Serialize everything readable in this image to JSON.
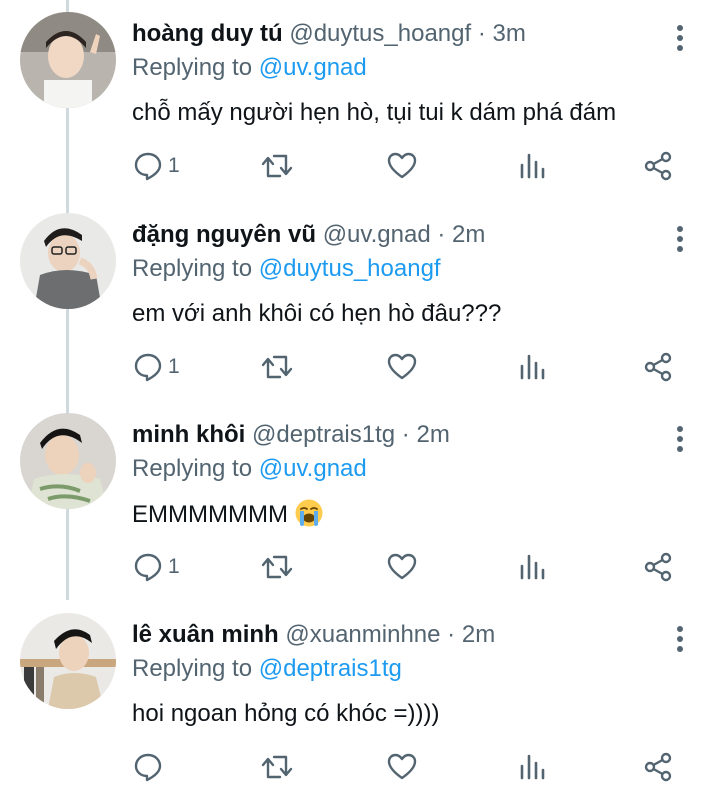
{
  "colors": {
    "accent": "#1d9bf0",
    "muted": "#536471",
    "text": "#0f1419",
    "thread_line": "#cfd9de"
  },
  "icons": {
    "reply": "reply-icon",
    "retweet": "retweet-icon",
    "like": "heart-icon",
    "views": "views-icon",
    "share": "share-icon",
    "more": "more-vertical-icon"
  },
  "replies": [
    {
      "name": "hoàng duy tú",
      "handle": "@duytus_hoangf",
      "separator": "·",
      "time": "3m",
      "replying_prefix": "Replying to",
      "replying_to": "@uv.gnad",
      "text": "chỗ mấy người hẹn hò, tụi tui k dám phá đám",
      "emoji": "",
      "reply_count": "1"
    },
    {
      "name": "đặng nguyên vũ",
      "handle": "@uv.gnad",
      "separator": "·",
      "time": "2m",
      "replying_prefix": "Replying to",
      "replying_to": "@duytus_hoangf",
      "text": "em với anh khôi có hẹn hò đâu???",
      "emoji": "",
      "reply_count": "1"
    },
    {
      "name": "minh khôi",
      "handle": "@deptrais1tg",
      "separator": "·",
      "time": "2m",
      "replying_prefix": "Replying to",
      "replying_to": "@uv.gnad",
      "text": "EMMMMMMM",
      "emoji": "loudly-crying-face",
      "reply_count": "1"
    },
    {
      "name": "lê xuân minh",
      "handle": "@xuanminhne",
      "separator": "·",
      "time": "2m",
      "replying_prefix": "Replying to",
      "replying_to": "@deptrais1tg",
      "text": "hoi ngoan hỏng có khóc =))))",
      "emoji": "",
      "reply_count": ""
    }
  ]
}
